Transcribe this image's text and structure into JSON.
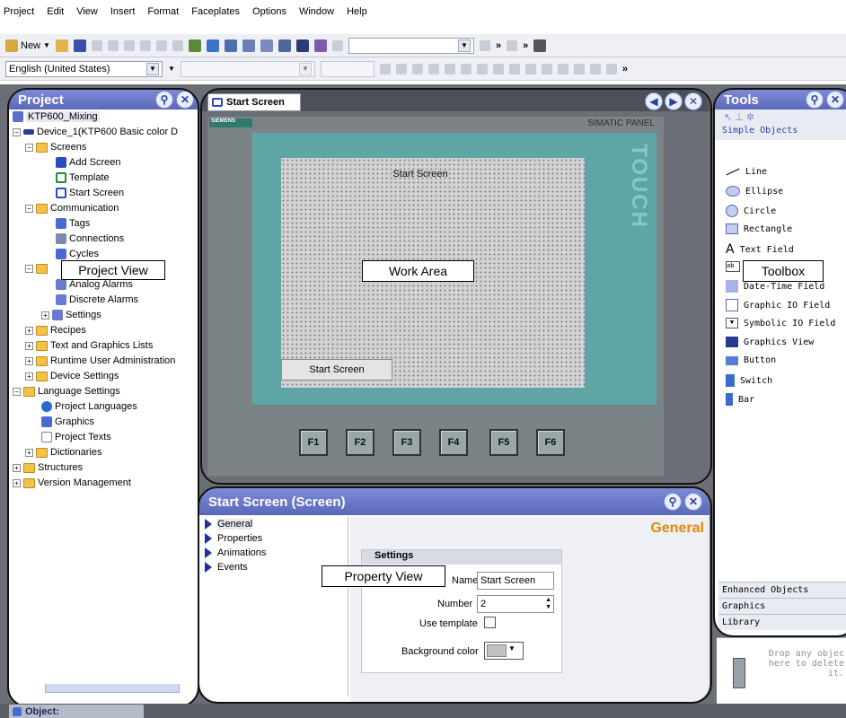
{
  "menu": [
    "Project",
    "Edit",
    "View",
    "Insert",
    "Format",
    "Faceplates",
    "Options",
    "Window",
    "Help"
  ],
  "toolbar1": {
    "new_label": "New"
  },
  "toolbar2": {
    "language": "English (United States)"
  },
  "project_panel": {
    "title": "Project",
    "tree": [
      "KTP600_Mixing",
      "Device_1(KTP600 Basic color D",
      "Screens",
      "Add Screen",
      "Template",
      "Start Screen",
      "Communication",
      "Tags",
      "Connections",
      "Cycles",
      "Analog Alarms",
      "Discrete Alarms",
      "Settings",
      "Recipes",
      "Text and Graphics Lists",
      "Runtime User Administration",
      "Device Settings",
      "Language Settings",
      "Project Languages",
      "Graphics",
      "Project Texts",
      "Dictionaries",
      "Structures",
      "Version Management"
    ]
  },
  "work_area": {
    "tab": "Start Screen",
    "brand": "SIEMENS",
    "panel_label": "SIMATIC PANEL",
    "touch_label": "TOUCH",
    "screen_title": "Start Screen",
    "screen_button": "Start Screen",
    "fkeys": [
      "F1",
      "F2",
      "F3",
      "F4",
      "F5",
      "F6"
    ]
  },
  "tools_panel": {
    "title": "Tools",
    "category": "Simple Objects",
    "items": [
      "Line",
      "Ellipse",
      "Circle",
      "Rectangle",
      "Text Field",
      "Date-Time Field",
      "Graphic IO Field",
      "Symbolic IO Field",
      "Graphics View",
      "Button",
      "Switch",
      "Bar"
    ],
    "tabs": [
      "Enhanced Objects",
      "Graphics",
      "Library"
    ],
    "drop_text": "Drop any objec here to delete it."
  },
  "property_view": {
    "title": "Start Screen (Screen)",
    "nav": [
      "General",
      "Properties",
      "Animations",
      "Events"
    ],
    "section_title": "General",
    "settings_label": "Settings",
    "name_label": "Name",
    "name_value": "Start Screen",
    "number_label": "Number",
    "number_value": "2",
    "use_template_label": "Use template",
    "bg_color_label": "Background color"
  },
  "callouts": {
    "project_view": "Project View",
    "work_area": "Work Area",
    "toolbox": "Toolbox",
    "property_view": "Property View"
  },
  "status": {
    "object_label": "Object:"
  }
}
